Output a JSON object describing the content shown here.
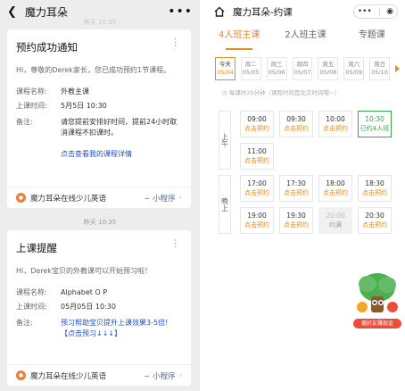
{
  "left": {
    "nav": {
      "back_icon": "back-arrow-icon",
      "title": "魔力耳朵",
      "more_icon": "more-dots-icon"
    },
    "ts_top": "昨天 10:35",
    "card1": {
      "title": "预约成功通知",
      "subtitle": "Hi，尊敬的Derek家长，您已成功预约1节课程。",
      "rows": [
        {
          "k": "课程名称:",
          "v": "外教主课"
        },
        {
          "k": "上课时间:",
          "v": "5月5日 10:30"
        },
        {
          "k": "备注:",
          "v": "请您提前安排好时间，提前24小时取消课程不扣课时。"
        }
      ],
      "link": "点击查看我的课程详情",
      "foot_name": "魔力耳朵在线少儿英语",
      "foot_mp": "小程序"
    },
    "ts_mid": "昨天 10:35",
    "card2": {
      "title": "上课提醒",
      "subtitle": "Hi，Derek宝贝的外教课可以开始预习啦！",
      "rows": [
        {
          "k": "课程名称:",
          "v": "Alphabet O P"
        },
        {
          "k": "上课时间:",
          "v": "05月05日 10:30"
        },
        {
          "k": "备注:",
          "v": "预习帮助宝贝提升上课效果3-5倍!【点击预习↓↓↓】"
        }
      ],
      "foot_name": "魔力耳朵在线少儿英语",
      "foot_mp": "小程序"
    }
  },
  "right": {
    "nav": {
      "home_icon": "home-icon",
      "title": "魔力耳朵-约课",
      "capsule_more": "•••",
      "capsule_close": "◉"
    },
    "tabs": [
      {
        "label": "4人班主课",
        "active": true
      },
      {
        "label": "2人班主课",
        "active": false
      },
      {
        "label": "专题课",
        "active": false
      }
    ],
    "days": [
      {
        "name": "今天",
        "date": "05/04",
        "selected": true
      },
      {
        "name": "周二",
        "date": "05/05",
        "selected": false
      },
      {
        "name": "周三",
        "date": "05/06",
        "selected": false
      },
      {
        "name": "周四",
        "date": "05/07",
        "selected": false
      },
      {
        "name": "周五",
        "date": "05/08",
        "selected": false
      },
      {
        "name": "周六",
        "date": "05/09",
        "selected": false
      },
      {
        "name": "周日",
        "date": "05/10",
        "selected": false
      }
    ],
    "note": "每课时25分钟（课程时间是北京时间哦~）",
    "morning_label": "上午",
    "evening_label": "晚上",
    "morning_slots": [
      {
        "time": "09:00",
        "status": "点击预约",
        "state": "open"
      },
      {
        "time": "09:30",
        "status": "点击预约",
        "state": "open"
      },
      {
        "time": "10:00",
        "status": "点击预约",
        "state": "open"
      },
      {
        "time": "10:30",
        "status": "已约4人班",
        "state": "booked"
      },
      {
        "time": "11:00",
        "status": "点击预约",
        "state": "open"
      }
    ],
    "evening_slots": [
      {
        "time": "17:00",
        "status": "点击预约",
        "state": "open"
      },
      {
        "time": "17:30",
        "status": "点击预约",
        "state": "open"
      },
      {
        "time": "18:00",
        "status": "点击预约",
        "state": "open"
      },
      {
        "time": "18:30",
        "status": "点击预约",
        "state": "open"
      },
      {
        "time": "19:00",
        "status": "点击预约",
        "state": "open"
      },
      {
        "time": "19:30",
        "status": "点击预约",
        "state": "open"
      },
      {
        "time": "20:00",
        "status": "约满",
        "state": "full"
      },
      {
        "time": "20:30",
        "status": "点击预约",
        "state": "open"
      }
    ],
    "mascot_label": "邀好友赚现金",
    "colors": {
      "accent": "#e68a1a",
      "booked": "#3aa64b",
      "link": "#1e50c8"
    }
  }
}
